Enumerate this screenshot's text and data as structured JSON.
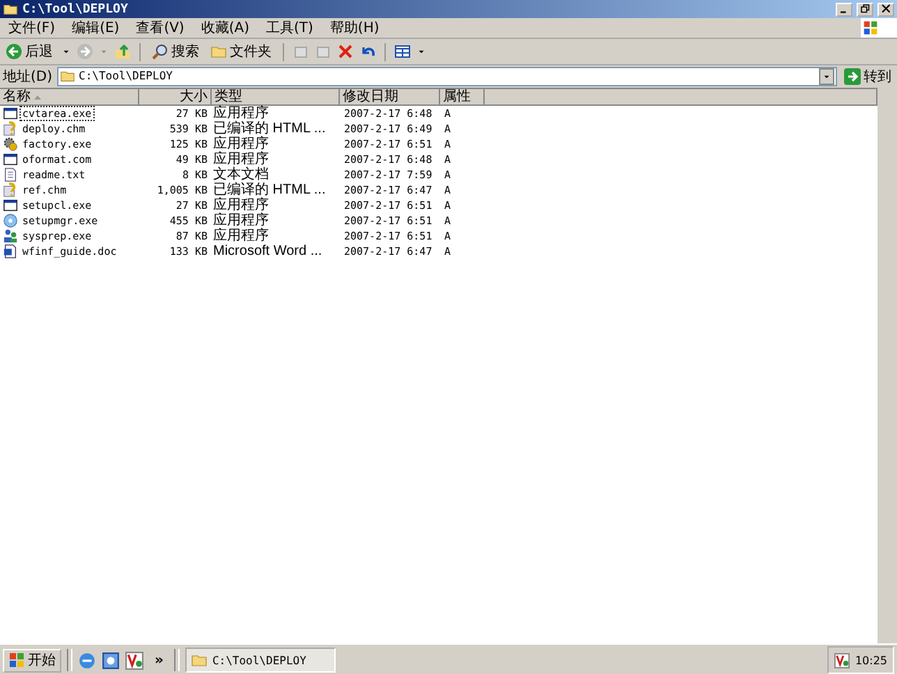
{
  "window": {
    "title": "C:\\Tool\\DEPLOY"
  },
  "menu": [
    "文件(F)",
    "编辑(E)",
    "查看(V)",
    "收藏(A)",
    "工具(T)",
    "帮助(H)"
  ],
  "toolbar": {
    "back": "后退",
    "search": "搜索",
    "folders": "文件夹"
  },
  "address": {
    "label": "地址(D)",
    "value": "C:\\Tool\\DEPLOY",
    "go": "转到"
  },
  "table": {
    "columns": [
      {
        "label": "名称",
        "sorted": true
      },
      {
        "label": "大小",
        "sorted": false
      },
      {
        "label": "类型",
        "sorted": false
      },
      {
        "label": "修改日期",
        "sorted": false
      },
      {
        "label": "属性",
        "sorted": false
      }
    ],
    "rows": [
      {
        "kind": "app",
        "name": "cvtarea.exe",
        "size": "27 KB",
        "type": "应用程序",
        "date": "2007-2-17 6:48",
        "attr": "A",
        "selected": true
      },
      {
        "kind": "help",
        "name": "deploy.chm",
        "size": "539 KB",
        "type": "已编译的 HTML ...",
        "date": "2007-2-17 6:49",
        "attr": "A",
        "selected": false
      },
      {
        "kind": "gear",
        "name": "factory.exe",
        "size": "125 KB",
        "type": "应用程序",
        "date": "2007-2-17 6:51",
        "attr": "A",
        "selected": false
      },
      {
        "kind": "app",
        "name": "oformat.com",
        "size": "49 KB",
        "type": "应用程序",
        "date": "2007-2-17 6:48",
        "attr": "A",
        "selected": false
      },
      {
        "kind": "text",
        "name": "readme.txt",
        "size": "8 KB",
        "type": "文本文档",
        "date": "2007-2-17 7:59",
        "attr": "A",
        "selected": false
      },
      {
        "kind": "help",
        "name": "ref.chm",
        "size": "1,005 KB",
        "type": "已编译的 HTML ...",
        "date": "2007-2-17 6:47",
        "attr": "A",
        "selected": false
      },
      {
        "kind": "app",
        "name": "setupcl.exe",
        "size": "27 KB",
        "type": "应用程序",
        "date": "2007-2-17 6:51",
        "attr": "A",
        "selected": false
      },
      {
        "kind": "disc",
        "name": "setupmgr.exe",
        "size": "455 KB",
        "type": "应用程序",
        "date": "2007-2-17 6:51",
        "attr": "A",
        "selected": false
      },
      {
        "kind": "people",
        "name": "sysprep.exe",
        "size": "87 KB",
        "type": "应用程序",
        "date": "2007-2-17 6:51",
        "attr": "A",
        "selected": false
      },
      {
        "kind": "doc",
        "name": "wfinf_guide.doc",
        "size": "133 KB",
        "type": "Microsoft Word ...",
        "date": "2007-2-17 6:47",
        "attr": "A",
        "selected": false
      }
    ]
  },
  "taskbar": {
    "start": "开始",
    "more": "»",
    "task": "C:\\Tool\\DEPLOY",
    "clock": "10:25"
  }
}
